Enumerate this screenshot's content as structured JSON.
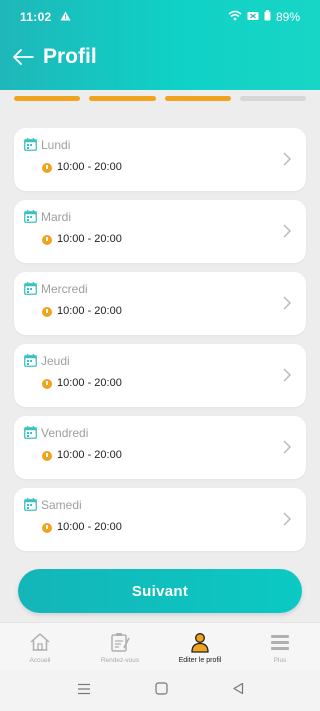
{
  "status_bar": {
    "time": "11:02",
    "battery": "89%"
  },
  "header": {
    "title": "Profil"
  },
  "progress": {
    "total_steps": 4,
    "completed_steps": 3
  },
  "schedule": [
    {
      "day": "Lundi",
      "hours": "10:00 - 20:00"
    },
    {
      "day": "Mardi",
      "hours": "10:00 - 20:00"
    },
    {
      "day": "Mercredi",
      "hours": "10:00 - 20:00"
    },
    {
      "day": "Jeudi",
      "hours": "10:00 - 20:00"
    },
    {
      "day": "Vendredi",
      "hours": "10:00 - 20:00"
    },
    {
      "day": "Samedi",
      "hours": "10:00 - 20:00"
    }
  ],
  "next_button": {
    "label": "Suivant"
  },
  "bottom_nav": [
    {
      "label": "Accueil",
      "icon": "home-icon"
    },
    {
      "label": "Rendez-vous",
      "icon": "appointment-icon"
    },
    {
      "label": "Editer le profil",
      "icon": "profile-icon",
      "active": true
    },
    {
      "label": "Plus",
      "icon": "menu-icon"
    }
  ],
  "colors": {
    "header": "#0fd1c6",
    "accent": "#f2a31e",
    "button": "#14b5b8",
    "calendar_icon": "#3cc3c0"
  }
}
